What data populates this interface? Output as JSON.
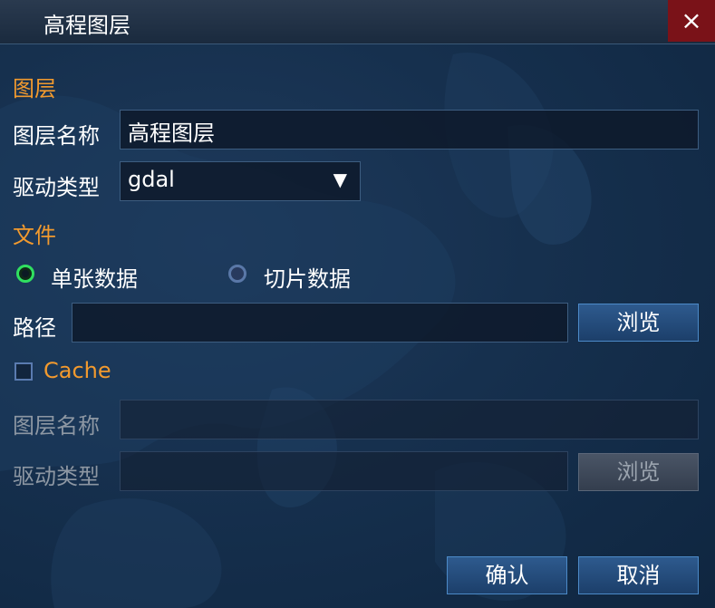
{
  "window": {
    "title": "高程图层",
    "close_icon": "×"
  },
  "layer_section": {
    "heading": "图层",
    "name_label": "图层名称",
    "name_value": "高程图层",
    "driver_label": "驱动类型",
    "driver_value": "gdal",
    "dropdown_arrow": "▼"
  },
  "file_section": {
    "heading": "文件",
    "radio_single": "单张数据",
    "radio_tiled": "切片数据",
    "selected": "single",
    "path_label": "路径",
    "path_value": "",
    "browse_label": "浏览"
  },
  "cache_section": {
    "checkbox_label": "Cache",
    "checked": false,
    "name_label": "图层名称",
    "name_value": "",
    "driver_label": "驱动类型",
    "driver_value": "",
    "browse_label": "浏览"
  },
  "footer": {
    "confirm_label": "确认",
    "cancel_label": "取消"
  },
  "colors": {
    "accent": "#f29a2e",
    "close_bg": "#7a1218",
    "radio_selected": "#30e060",
    "button_border": "#4c8ac8"
  }
}
